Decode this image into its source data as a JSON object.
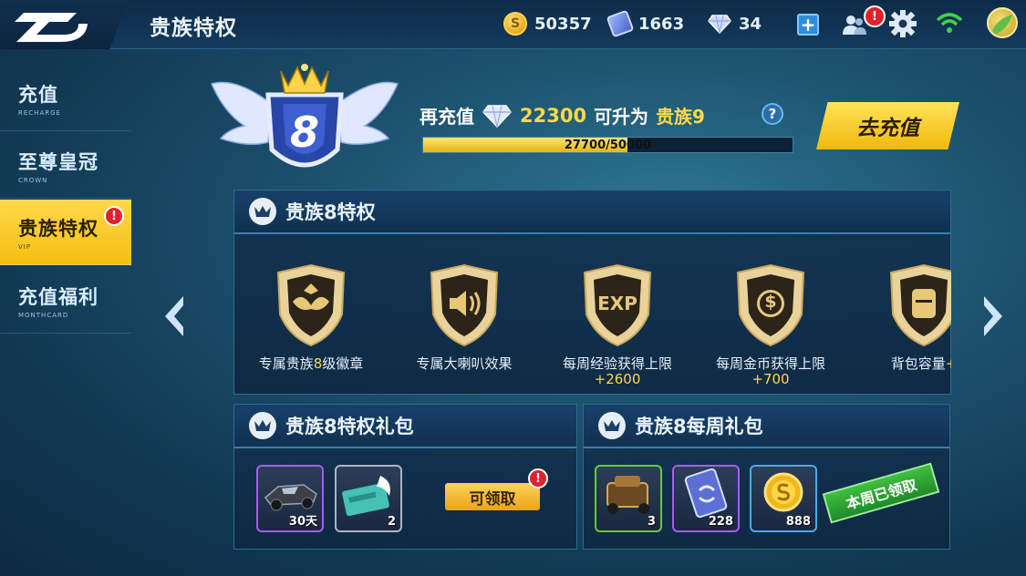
{
  "header": {
    "title": "贵族特权",
    "coins": "50357",
    "coupons": "1663",
    "diamonds": "34"
  },
  "sidebar": {
    "items": [
      {
        "label": "充值",
        "sub": "RECHARGE"
      },
      {
        "label": "至尊皇冠",
        "sub": "CROWN"
      },
      {
        "label": "贵族特权",
        "sub": "VIP"
      },
      {
        "label": "充值福利",
        "sub": "MONTHCARD"
      }
    ],
    "active_index": 2,
    "badge": "!"
  },
  "vip": {
    "level_badge": "8",
    "recharge_prefix": "再充值",
    "recharge_amount": "22300",
    "upgrade_text": "可升为",
    "next_level": "贵族9",
    "help": "?",
    "progress_text": "27700/50000",
    "progress_fraction": 0.554,
    "go_recharge": "去充值"
  },
  "privileges": {
    "title": "贵族8特权",
    "perks": [
      {
        "icon": "wings-badge-icon",
        "label_a": "专属贵族",
        "label_hl": "8",
        "label_b": "级徽章"
      },
      {
        "icon": "speaker-icon",
        "label_a": "专属大喇叭效果",
        "label_hl": "",
        "label_b": ""
      },
      {
        "icon": "exp-icon",
        "icon_text": "EXP",
        "label_a": "每周经验获得上限",
        "label_hl": "+2600",
        "label_b": ""
      },
      {
        "icon": "coin-dollar-icon",
        "icon_text": "$",
        "label_a": "每周金币获得上限",
        "label_hl": "+700",
        "label_b": ""
      },
      {
        "icon": "backpack-icon",
        "label_a": "背包容量",
        "label_hl": "+",
        "label_b": ""
      }
    ]
  },
  "gift_pack": {
    "title": "贵族8特权礼包",
    "items": [
      {
        "icon": "kart-icon",
        "qty": "30天"
      },
      {
        "icon": "ticket-icon",
        "qty": "2"
      }
    ],
    "claim_label": "可领取",
    "claim_badge": "!"
  },
  "weekly_pack": {
    "title": "贵族8每周礼包",
    "items": [
      {
        "icon": "treasure-kart-icon",
        "qty": "3"
      },
      {
        "icon": "coupon-card-icon",
        "qty": "228"
      },
      {
        "icon": "gold-coin-icon",
        "qty": "888"
      }
    ],
    "claimed_label": "本周已领取"
  },
  "colors": {
    "accent_yellow": "#ffd84a",
    "panel_bg": "#133452",
    "alert_red": "#e0222c",
    "claimed_green": "#2a9e33"
  }
}
